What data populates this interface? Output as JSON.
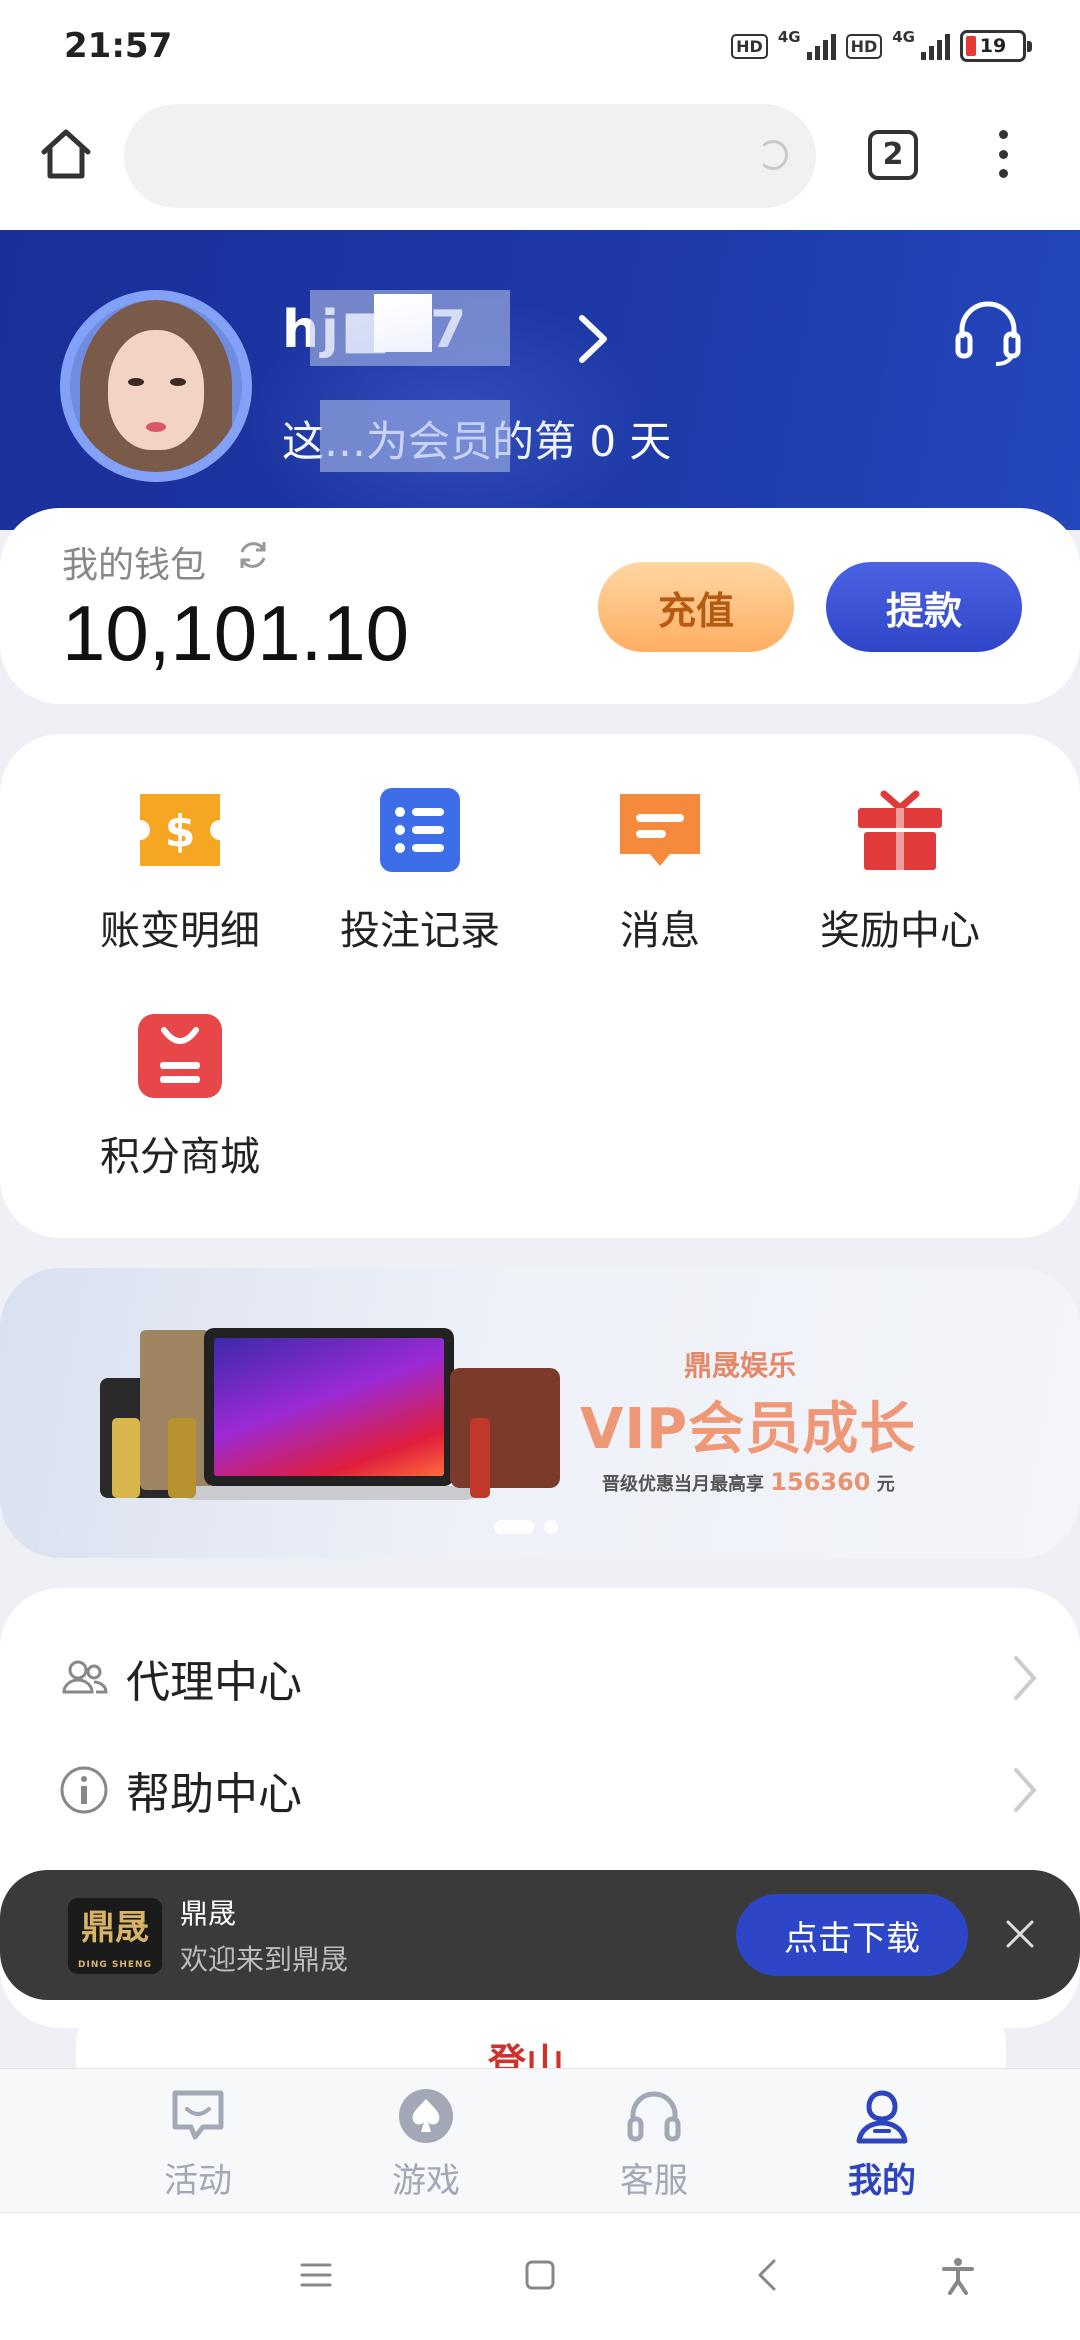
{
  "status_bar": {
    "time": "21:57",
    "network": "4G",
    "battery": "19"
  },
  "browser": {
    "tab_count": "2"
  },
  "profile": {
    "username": "hj■87",
    "member_text": "这…为会员的第 0 天"
  },
  "wallet": {
    "label": "我的钱包",
    "balance": "10,101.10",
    "recharge_label": "充值",
    "withdraw_label": "提款"
  },
  "menu": {
    "items": [
      {
        "label": "账变明细",
        "icon": "ticket-dollar-icon"
      },
      {
        "label": "投注记录",
        "icon": "list-icon"
      },
      {
        "label": "消息",
        "icon": "message-icon"
      },
      {
        "label": "奖励中心",
        "icon": "gift-icon"
      },
      {
        "label": "积分商城",
        "icon": "shopping-bag-icon"
      }
    ]
  },
  "banner": {
    "brand": "鼎晟娱乐",
    "title": "VIP会员成长",
    "subtitle_prefix": "晋级优惠当月最高享",
    "amount": "156360",
    "unit": "元"
  },
  "list": {
    "items": [
      {
        "label": "代理中心",
        "icon": "users-icon"
      },
      {
        "label": "帮助中心",
        "icon": "info-icon"
      }
    ]
  },
  "download_bar": {
    "logo_text": "鼎晟",
    "logo_sub": "DING SHENG",
    "app_name": "鼎晟",
    "welcome": "欢迎来到鼎晟",
    "button_label": "点击下载"
  },
  "peek_text": "登山",
  "tabs": [
    {
      "label": "活动",
      "icon": "chat-icon"
    },
    {
      "label": "游戏",
      "icon": "spade-icon"
    },
    {
      "label": "客服",
      "icon": "headset-icon"
    },
    {
      "label": "我的",
      "icon": "user-icon",
      "active": true
    }
  ],
  "colors": {
    "primary": "#2d44c0",
    "header_bg": "#1d3aa8",
    "recharge": "#ffae62",
    "inactive_tab": "#a3a8b6"
  }
}
